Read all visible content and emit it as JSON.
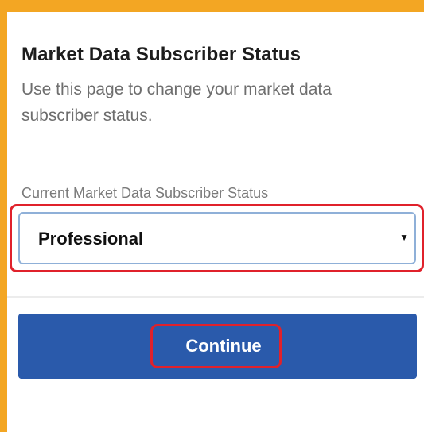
{
  "page": {
    "title": "Market Data Subscriber Status",
    "description": "Use this page to change your market data subscriber status."
  },
  "form": {
    "field_label": "Current Market Data Subscriber Status",
    "selected_value": "Professional",
    "arrow_icon": "dropdown-caret-icon"
  },
  "actions": {
    "continue_label": "Continue"
  },
  "colors": {
    "frame": "#f3a623",
    "button": "#2a5aab",
    "highlight": "#e0212b",
    "select_border": "#8fb0d8"
  }
}
